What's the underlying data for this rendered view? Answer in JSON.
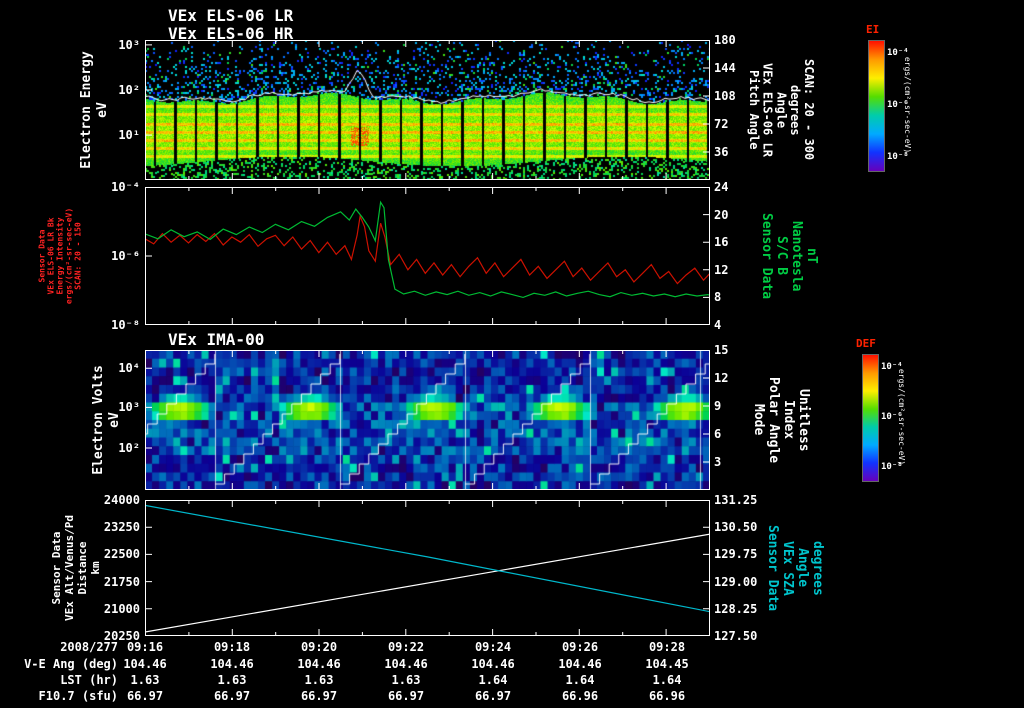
{
  "display": {
    "date_label": "2008/277"
  },
  "time_axis": {
    "t_range": [
      0,
      13
    ],
    "ticks": [
      {
        "t": "09:16",
        "f": 0.0
      },
      {
        "t": "09:18",
        "f": 0.1538
      },
      {
        "t": "09:20",
        "f": 0.3077
      },
      {
        "t": "09:22",
        "f": 0.4615
      },
      {
        "t": "09:24",
        "f": 0.6154
      },
      {
        "t": "09:26",
        "f": 0.7692
      },
      {
        "t": "09:28",
        "f": 0.9231
      }
    ]
  },
  "table": {
    "rows": [
      {
        "label": "V-E Ang (deg)",
        "values": [
          "104.46",
          "104.46",
          "104.46",
          "104.46",
          "104.46",
          "104.46",
          "104.45"
        ]
      },
      {
        "label": "LST (hr)",
        "values": [
          "1.63",
          "1.63",
          "1.63",
          "1.63",
          "1.64",
          "1.64",
          "1.64"
        ]
      },
      {
        "label": "F10.7 (sfu)",
        "values": [
          "66.97",
          "66.97",
          "66.97",
          "66.97",
          "66.97",
          "66.96",
          "66.96"
        ]
      }
    ]
  },
  "colorbars": [
    {
      "name": "EI",
      "title": "EI",
      "unit": "ergs/(cm²-sr-sec-eV)",
      "ticks": [
        {
          "t": "10⁻⁴",
          "f": 0.1
        },
        {
          "t": "10⁻⁶",
          "f": 0.5
        },
        {
          "t": "10⁻⁸",
          "f": 0.9
        }
      ],
      "colors": [
        "#ff1000",
        "#ff9900",
        "#fdee00",
        "#55dd00",
        "#00ccaa",
        "#00aaff",
        "#1133ff",
        "#6600bb"
      ]
    },
    {
      "name": "DEF",
      "title": "DEF",
      "unit": "ergs/(cm²-sr-sec-eV)",
      "ticks": [
        {
          "t": "10⁻⁴",
          "f": 0.1
        },
        {
          "t": "10⁻⁶",
          "f": 0.5
        },
        {
          "t": "10⁻⁸",
          "f": 0.9
        }
      ],
      "colors": [
        "#ff1000",
        "#ff9900",
        "#fdee00",
        "#55dd00",
        "#00ccaa",
        "#00aaff",
        "#1133ff",
        "#6600bb"
      ]
    }
  ],
  "chart_data": [
    {
      "id": "els-electron-spectrogram",
      "type": "heatmap",
      "titles": [
        "VEx ELS-06 LR",
        "VEx ELS-06 HR"
      ],
      "ylabel_lines": [
        "Electron Energy",
        "eV"
      ],
      "y_scale": "log",
      "y_range_ev": [
        1,
        1250
      ],
      "left_ticks": [
        {
          "t": "10³",
          "f": 0.035
        },
        {
          "t": "10²",
          "f": 0.357
        },
        {
          "t": "10¹",
          "f": 0.679
        }
      ],
      "right_ticks": [
        {
          "t": "180",
          "f": 0.0
        },
        {
          "t": "144",
          "f": 0.2
        },
        {
          "t": "108",
          "f": 0.4
        },
        {
          "t": "72",
          "f": 0.6
        },
        {
          "t": "36",
          "f": 0.8
        }
      ],
      "right_label_lines": [
        "Pitch Angle",
        "VEx ELS-06 LR",
        "Angle",
        "degrees",
        "SCAN: 20 - 300"
      ],
      "colorbar": "EI",
      "features": {
        "main_band_ev": [
          3,
          45
        ],
        "band_intensity": "green-yellow, horizontal yellow streaks",
        "scan_gaps": "periodic vertical black gaps, ~32 s cadence",
        "speckles": "sparse cyan-blue counts above 100 eV",
        "white_trace": "thin white line along band top with spike near 09:21",
        "hot_spot_time": "09:21"
      }
    },
    {
      "id": "intensity-and-bfield",
      "type": "line",
      "left_label_lines": [
        "Sensor Data",
        "VEx ELS-06 LR Bk",
        "Energy Intensity",
        "ergs/(cm²-sr-sec-eV)",
        "SCAN: 20 - 150"
      ],
      "left_ticks": [
        {
          "t": "10⁻⁴",
          "f": 0.0
        },
        {
          "t": "10⁻⁶",
          "f": 0.5
        },
        {
          "t": "10⁻⁸",
          "f": 1.0
        }
      ],
      "right_ticks": [
        {
          "t": "24",
          "f": 0.0
        },
        {
          "t": "20",
          "f": 0.2
        },
        {
          "t": "16",
          "f": 0.4
        },
        {
          "t": "12",
          "f": 0.6
        },
        {
          "t": "8",
          "f": 0.8
        },
        {
          "t": "4",
          "f": 1.0
        }
      ],
      "right_label_lines": [
        "Sensor Data",
        "S/C B",
        "Nanotesla",
        "nT"
      ],
      "series": [
        {
          "name": "electron-intensity",
          "color": "#cc1100",
          "yscale": "log10-exponent",
          "ytop": -4,
          "ybottom": -8,
          "points": [
            [
              0,
              -5.5
            ],
            [
              0.2,
              -5.65
            ],
            [
              0.4,
              -5.35
            ],
            [
              0.6,
              -5.6
            ],
            [
              0.8,
              -5.4
            ],
            [
              1.0,
              -5.62
            ],
            [
              1.2,
              -5.38
            ],
            [
              1.4,
              -5.58
            ],
            [
              1.6,
              -5.35
            ],
            [
              1.8,
              -5.68
            ],
            [
              2.0,
              -5.45
            ],
            [
              2.2,
              -5.6
            ],
            [
              2.4,
              -5.38
            ],
            [
              2.6,
              -5.72
            ],
            [
              2.8,
              -5.5
            ],
            [
              3.0,
              -5.4
            ],
            [
              3.2,
              -5.7
            ],
            [
              3.4,
              -5.45
            ],
            [
              3.6,
              -5.8
            ],
            [
              3.8,
              -5.55
            ],
            [
              4.0,
              -5.9
            ],
            [
              4.2,
              -5.6
            ],
            [
              4.4,
              -5.95
            ],
            [
              4.6,
              -5.7
            ],
            [
              4.75,
              -6.1
            ],
            [
              4.88,
              -5.4
            ],
            [
              4.95,
              -4.85
            ],
            [
              5.05,
              -5.15
            ],
            [
              5.15,
              -5.85
            ],
            [
              5.3,
              -6.15
            ],
            [
              5.42,
              -5.05
            ],
            [
              5.52,
              -5.45
            ],
            [
              5.65,
              -6.25
            ],
            [
              5.85,
              -5.95
            ],
            [
              6.05,
              -6.4
            ],
            [
              6.25,
              -6.1
            ],
            [
              6.45,
              -6.5
            ],
            [
              6.65,
              -6.2
            ],
            [
              6.85,
              -6.55
            ],
            [
              7.05,
              -6.25
            ],
            [
              7.25,
              -6.6
            ],
            [
              7.45,
              -6.3
            ],
            [
              7.65,
              -6.05
            ],
            [
              7.85,
              -6.5
            ],
            [
              8.05,
              -6.2
            ],
            [
              8.25,
              -6.6
            ],
            [
              8.45,
              -6.35
            ],
            [
              8.65,
              -6.1
            ],
            [
              8.85,
              -6.55
            ],
            [
              9.05,
              -6.3
            ],
            [
              9.25,
              -6.65
            ],
            [
              9.45,
              -6.4
            ],
            [
              9.65,
              -6.15
            ],
            [
              9.85,
              -6.6
            ],
            [
              10.05,
              -6.35
            ],
            [
              10.25,
              -6.7
            ],
            [
              10.45,
              -6.45
            ],
            [
              10.65,
              -6.2
            ],
            [
              10.85,
              -6.6
            ],
            [
              11.05,
              -6.4
            ],
            [
              11.25,
              -6.75
            ],
            [
              11.45,
              -6.5
            ],
            [
              11.65,
              -6.25
            ],
            [
              11.85,
              -6.65
            ],
            [
              12.05,
              -6.45
            ],
            [
              12.25,
              -6.8
            ],
            [
              12.45,
              -6.55
            ],
            [
              12.65,
              -6.35
            ],
            [
              12.85,
              -6.7
            ],
            [
              13,
              -6.5
            ]
          ]
        },
        {
          "name": "magnetic-field-B",
          "color": "#00bb33",
          "yscale": "linear",
          "ytop": 24,
          "ybottom": 4,
          "points": [
            [
              0,
              17.2
            ],
            [
              0.3,
              16.5
            ],
            [
              0.6,
              17.8
            ],
            [
              0.9,
              16.8
            ],
            [
              1.2,
              17.5
            ],
            [
              1.5,
              16.4
            ],
            [
              1.8,
              17.9
            ],
            [
              2.1,
              17.1
            ],
            [
              2.4,
              18.2
            ],
            [
              2.7,
              17.4
            ],
            [
              3.0,
              18.6
            ],
            [
              3.3,
              17.8
            ],
            [
              3.6,
              19.0
            ],
            [
              3.9,
              18.3
            ],
            [
              4.2,
              19.6
            ],
            [
              4.5,
              20.4
            ],
            [
              4.7,
              19.2
            ],
            [
              4.85,
              20.8
            ],
            [
              5.0,
              19.6
            ],
            [
              5.15,
              18.2
            ],
            [
              5.3,
              16.2
            ],
            [
              5.42,
              21.8
            ],
            [
              5.5,
              21.0
            ],
            [
              5.6,
              13.5
            ],
            [
              5.75,
              9.2
            ],
            [
              5.95,
              8.5
            ],
            [
              6.2,
              8.9
            ],
            [
              6.45,
              8.3
            ],
            [
              6.7,
              8.8
            ],
            [
              6.95,
              8.4
            ],
            [
              7.2,
              8.9
            ],
            [
              7.45,
              8.3
            ],
            [
              7.7,
              8.7
            ],
            [
              7.95,
              8.2
            ],
            [
              8.2,
              8.8
            ],
            [
              8.45,
              8.4
            ],
            [
              8.7,
              8.0
            ],
            [
              8.95,
              8.6
            ],
            [
              9.2,
              8.3
            ],
            [
              9.45,
              8.8
            ],
            [
              9.7,
              8.2
            ],
            [
              9.95,
              8.6
            ],
            [
              10.2,
              8.9
            ],
            [
              10.45,
              8.4
            ],
            [
              10.7,
              8.1
            ],
            [
              10.95,
              8.7
            ],
            [
              11.2,
              8.3
            ],
            [
              11.45,
              8.6
            ],
            [
              11.7,
              8.2
            ],
            [
              11.95,
              8.5
            ],
            [
              12.2,
              8.1
            ],
            [
              12.45,
              8.5
            ],
            [
              12.7,
              8.2
            ],
            [
              12.95,
              8.4
            ],
            [
              13,
              8.3
            ]
          ]
        }
      ]
    },
    {
      "id": "ima-ion-spectrogram",
      "type": "heatmap",
      "title": "VEx IMA-00",
      "ylabel_lines": [
        "Electron Volts",
        "eV"
      ],
      "y_scale": "log",
      "left_ticks": [
        {
          "t": "10⁴",
          "f": 0.13
        },
        {
          "t": "10³",
          "f": 0.41
        },
        {
          "t": "10²",
          "f": 0.7
        }
      ],
      "right_ticks": [
        {
          "t": "15",
          "f": 0.0
        },
        {
          "t": "12",
          "f": 0.2
        },
        {
          "t": "9",
          "f": 0.4
        },
        {
          "t": "6",
          "f": 0.6
        },
        {
          "t": "3",
          "f": 0.8
        }
      ],
      "right_label_lines": [
        "Mode",
        "Polar Angle",
        "Index",
        "Unitless"
      ],
      "colorbar": "DEF",
      "features": {
        "background": "dark blue mosaic of counts",
        "ion_peak_energy_ev": 1000,
        "peak_times": [
          "09:17",
          "09:20",
          "09:22:30",
          "09:25:30",
          "09:28"
        ],
        "white_sawtooth": "elevation-scan diagonal line repeating ~every 2.9 min",
        "vertical_dividers": "white scan-cycle separators"
      }
    },
    {
      "id": "altitude-and-sza",
      "type": "line",
      "left_label_lines": [
        "Sensor Data",
        "VEx Alt/Venus/Pd",
        "Distance",
        "km"
      ],
      "left_ticks": [
        {
          "t": "24000",
          "f": 0.0
        },
        {
          "t": "23250",
          "f": 0.2
        },
        {
          "t": "22500",
          "f": 0.4
        },
        {
          "t": "21750",
          "f": 0.6
        },
        {
          "t": "21000",
          "f": 0.8
        },
        {
          "t": "20250",
          "f": 1.0
        }
      ],
      "right_ticks": [
        {
          "t": "131.25",
          "f": 0.0
        },
        {
          "t": "130.50",
          "f": 0.2
        },
        {
          "t": "129.75",
          "f": 0.4
        },
        {
          "t": "129.00",
          "f": 0.6
        },
        {
          "t": "128.25",
          "f": 0.8
        },
        {
          "t": "127.50",
          "f": 1.0
        }
      ],
      "right_label_lines": [
        "Sensor Data",
        "VEx SZA",
        "Angle",
        "degrees"
      ],
      "series": [
        {
          "name": "altitude",
          "color": "#ffffff",
          "yscale": "linear",
          "ytop": 24000,
          "ybottom": 20250,
          "points": [
            [
              0,
              20360
            ],
            [
              13,
              23060
            ]
          ]
        },
        {
          "name": "solar-zenith-angle",
          "color": "#00b8cc",
          "yscale": "linear",
          "ytop": 131.25,
          "ybottom": 127.5,
          "points": [
            [
              0,
              131.1
            ],
            [
              6.5,
              129.68
            ],
            [
              13,
              128.17
            ]
          ]
        }
      ]
    }
  ]
}
